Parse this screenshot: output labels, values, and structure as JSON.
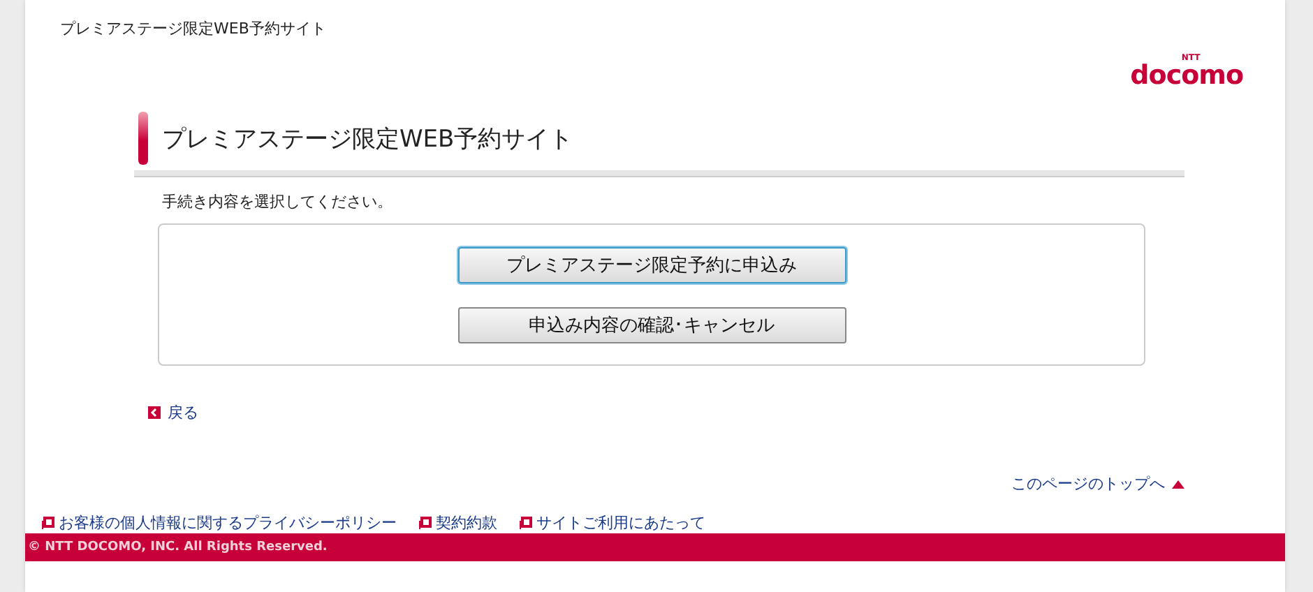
{
  "header": {
    "site_title": "プレミアステージ限定WEB予約サイト",
    "logo": {
      "small": "NTT",
      "name": "docomo"
    }
  },
  "main": {
    "heading": "プレミアステージ限定WEB予約サイト",
    "instruction": "手続き内容を選択してください。",
    "buttons": [
      {
        "label": "プレミアステージ限定予約に申込み",
        "focused": true
      },
      {
        "label": "申込み内容の確認･キャンセル",
        "focused": false
      }
    ],
    "back_link": "戻る",
    "top_link": "このページのトップへ"
  },
  "footer": {
    "links": [
      "お客様の個人情報に関するプライバシーポリシー",
      "契約約款",
      "サイトご利用にあたって"
    ],
    "copyright": "© NTT DOCOMO, INC. All Rights Reserved."
  }
}
